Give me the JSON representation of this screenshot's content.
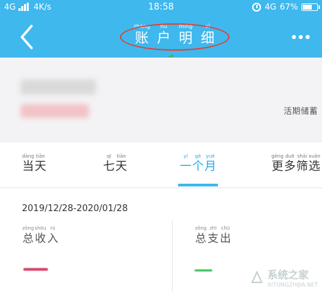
{
  "status_bar": {
    "network": "4G",
    "speed": "4K/s",
    "time": "18:58",
    "network_right": "4G",
    "battery_percent": "67%",
    "battery_level": 0.67
  },
  "header": {
    "title_chars": [
      {
        "pinyin": "zhàng",
        "char": "账"
      },
      {
        "pinyin": "hù",
        "char": "户"
      },
      {
        "pinyin": "míng",
        "char": "明"
      },
      {
        "pinyin": "xì",
        "char": "细"
      }
    ]
  },
  "summary": {
    "hint": "活期储蓄"
  },
  "tabs": [
    {
      "chars": [
        {
          "pinyin": "dāng",
          "char": "当"
        },
        {
          "pinyin": "tiān",
          "char": "天"
        }
      ]
    },
    {
      "chars": [
        {
          "pinyin": "qī",
          "char": "七"
        },
        {
          "pinyin": "tiān",
          "char": "天"
        }
      ]
    },
    {
      "chars": [
        {
          "pinyin": "yí",
          "char": "一"
        },
        {
          "pinyin": "gè",
          "char": "个"
        },
        {
          "pinyin": "yuè",
          "char": "月"
        }
      ]
    },
    {
      "chars": [
        {
          "pinyin": "gèng",
          "char": "更"
        },
        {
          "pinyin": "duō",
          "char": "多"
        },
        {
          "pinyin": "shāi",
          "char": "筛"
        },
        {
          "pinyin": "xuǎn",
          "char": "选"
        }
      ]
    }
  ],
  "details": {
    "date_range": "2019/12/28-2020/01/28",
    "income_label": [
      {
        "pinyin": "zǒng",
        "char": "总"
      },
      {
        "pinyin": "shōu",
        "char": "收"
      },
      {
        "pinyin": "rù",
        "char": "入"
      }
    ],
    "expense_label": [
      {
        "pinyin": "zǒng",
        "char": "总"
      },
      {
        "pinyin": "zhī",
        "char": "支"
      },
      {
        "pinyin": "chū",
        "char": "出"
      }
    ]
  },
  "watermark": {
    "text": "系统之家",
    "sub": "XITONGZHIJIA.NET"
  },
  "colors": {
    "header_bg": "#3fb8ee",
    "active_tab": "#27a8e8",
    "annotation_red": "#d8453c",
    "annotation_green": "#5cc84a"
  }
}
